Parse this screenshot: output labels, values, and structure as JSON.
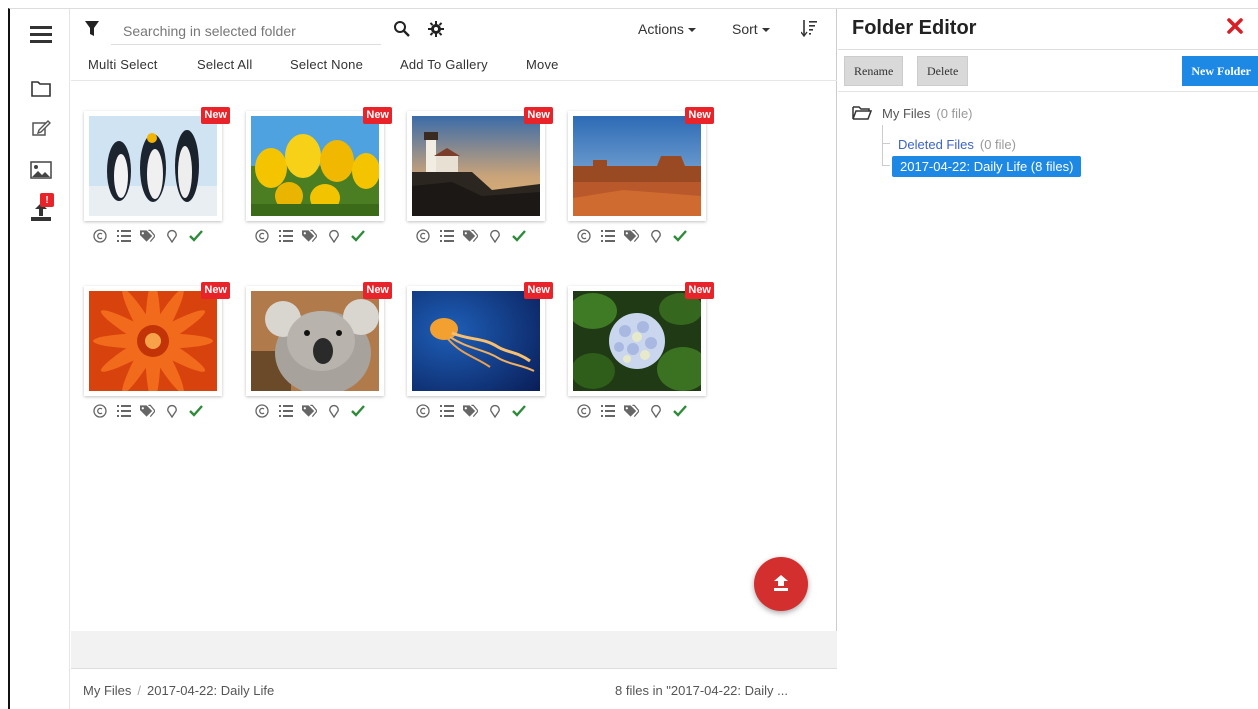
{
  "toolbar": {
    "search_placeholder": "Searching in selected folder",
    "actions_label": "Actions",
    "sort_label": "Sort"
  },
  "subbar": {
    "multi_select": "Multi Select",
    "select_all": "Select All",
    "select_none": "Select None",
    "add_to_gallery": "Add To Gallery",
    "move": "Move"
  },
  "rail": {
    "upload_badge": "!"
  },
  "grid": {
    "new_badge": "New",
    "items": [
      {
        "subject": "penguins"
      },
      {
        "subject": "tulips"
      },
      {
        "subject": "lighthouse"
      },
      {
        "subject": "desert"
      },
      {
        "subject": "chrysanthemum"
      },
      {
        "subject": "koala"
      },
      {
        "subject": "jellyfish"
      },
      {
        "subject": "hydrangeas"
      }
    ]
  },
  "footer": {
    "breadcrumb": [
      "My Files",
      "2017-04-22: Daily Life"
    ],
    "breadcrumb_sep": "/",
    "status": "8 files in \"2017-04-22: Daily ..."
  },
  "editor": {
    "title": "Folder Editor",
    "rename": "Rename",
    "delete": "Delete",
    "new_folder": "New Folder",
    "tree": {
      "root_label": "My Files",
      "root_count": "(0 file)",
      "deleted_label": "Deleted Files",
      "deleted_count": "(0 file)",
      "active_label": "2017-04-22: Daily Life  (8 files)"
    }
  },
  "colors": {
    "accent_blue": "#1e88e5",
    "badge_red": "#e8232a",
    "fab_red": "#d32f2f",
    "check_green": "#2e8b3a"
  }
}
